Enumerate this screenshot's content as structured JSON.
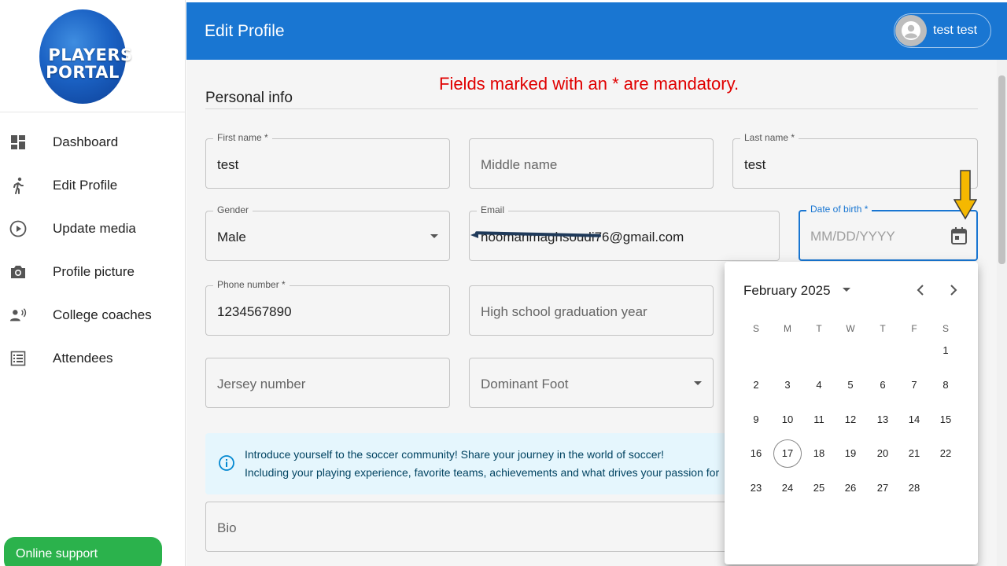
{
  "sidebar": {
    "logo_line1": "PLAYERS",
    "logo_line2": "PORTAL",
    "items": [
      {
        "label": "Dashboard",
        "icon": "dashboard-icon"
      },
      {
        "label": "Edit Profile",
        "icon": "runner-icon"
      },
      {
        "label": "Update media",
        "icon": "play-circle-icon"
      },
      {
        "label": "Profile picture",
        "icon": "camera-icon"
      },
      {
        "label": "College coaches",
        "icon": "speaker-person-icon"
      },
      {
        "label": "Attendees",
        "icon": "list-icon"
      }
    ],
    "support_label": "Online support"
  },
  "header": {
    "title": "Edit Profile",
    "user_name": "test test"
  },
  "form": {
    "mandatory_note": "Fields marked with an * are mandatory.",
    "section_title": "Personal info",
    "first_name": {
      "label": "First name *",
      "value": "test"
    },
    "middle_name": {
      "placeholder": "Middle name"
    },
    "last_name": {
      "label": "Last name *",
      "value": "test"
    },
    "gender": {
      "label": "Gender",
      "value": "Male"
    },
    "email": {
      "label": "Email",
      "value": "hoomanmaghsoudi76@gmail.com"
    },
    "dob": {
      "label": "Date of birth *",
      "placeholder": "MM/DD/YYYY"
    },
    "phone": {
      "label": "Phone number *",
      "value": "1234567890"
    },
    "grad_year": {
      "placeholder": "High school graduation year"
    },
    "jersey": {
      "placeholder": "Jersey number"
    },
    "foot": {
      "placeholder": "Dominant Foot"
    },
    "info_line1": "Introduce yourself to the soccer community! Share your journey in the world of soccer!",
    "info_line2": "Including your playing experience, favorite teams, achievements and what drives your passion for",
    "bio": {
      "placeholder": "Bio"
    }
  },
  "calendar": {
    "month_label": "February 2025",
    "weekdays": [
      "S",
      "M",
      "T",
      "W",
      "T",
      "F",
      "S"
    ],
    "first_weekday": 6,
    "days_in_month": 28,
    "today": 17
  },
  "colors": {
    "header": "#1976d2",
    "mandatory": "#e00000",
    "support": "#2bb24c",
    "info_bg": "#e5f6fd",
    "arrow": "#f5b800"
  }
}
